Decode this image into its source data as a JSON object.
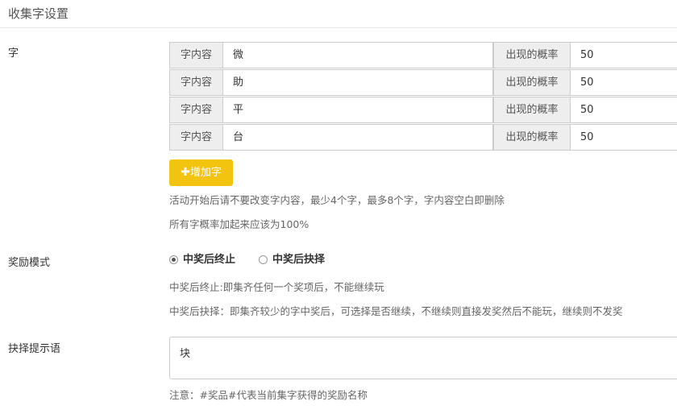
{
  "header": {
    "title": "收集字设置"
  },
  "chars": {
    "label": "字",
    "content_addon": "字内容",
    "prob_addon": "出现的概率",
    "items": [
      {
        "content": "微",
        "prob": "50"
      },
      {
        "content": "助",
        "prob": "50"
      },
      {
        "content": "平",
        "prob": "50"
      },
      {
        "content": "台",
        "prob": "50"
      }
    ],
    "add_button": "增加字",
    "help1": "活动开始后请不要改变字内容，最少4个字，最多8个字，字内容空白即删除",
    "help2": "所有字概率加起来应该为100%"
  },
  "reward_mode": {
    "label": "奖励模式",
    "options": [
      {
        "label": "中奖后终止",
        "checked": true
      },
      {
        "label": "中奖后抉择",
        "checked": false
      }
    ],
    "help1": "中奖后终止:即集齐任何一个奖项后，不能继续玩",
    "help2": "中奖后抉择：即集齐较少的字中奖后，可选择是否继续，不继续则直接发奖然后不能玩，继续则不发奖"
  },
  "prompt": {
    "label": "抉择提示语",
    "value": "块",
    "help": "注意：#奖品#代表当前集字获得的奖励名称"
  }
}
